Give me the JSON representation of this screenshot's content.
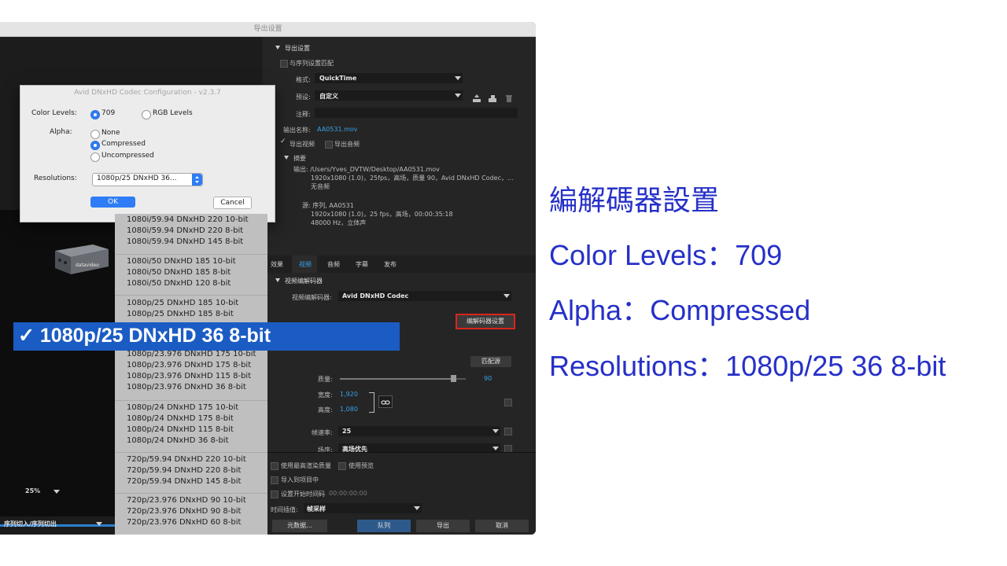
{
  "window": {
    "title": "导出设置"
  },
  "export_settings": {
    "section": "导出设置",
    "match_sequence": "与序列设置匹配",
    "format_label": "格式:",
    "format_value": "QuickTime",
    "preset_label": "预设:",
    "preset_value": "自定义",
    "comment_label": "注释:",
    "output_name_label": "输出名称:",
    "output_name_value": "AA0531.mov",
    "export_video": "导出视频",
    "export_audio": "导出音频",
    "summary": "摘要",
    "summary_output_1": "输出: /Users/Yves_DVTW/Desktop/AA0531.mov",
    "summary_output_2": "1920x1080 (1.0)，25fps，高场，质量 90，Avid DNxHD Codec，...",
    "summary_output_3": "无音频",
    "summary_source_1": "源: 序列, AA0531",
    "summary_source_2": "1920x1080 (1.0)，25 fps，高场，00:00:35:18",
    "summary_source_3": "48000 Hz，立体声"
  },
  "tabs": [
    "效果",
    "视频",
    "音频",
    "字幕",
    "发布"
  ],
  "video": {
    "codec_section": "视频编解码器",
    "codec_label": "视频编解码器:",
    "codec_value": "Avid DNxHD Codec",
    "codec_settings_button": "编解码器设置",
    "match_source_button": "匹配源",
    "quality_label": "质量:",
    "quality_value": "90",
    "width_label": "宽度:",
    "width_value": "1,920",
    "height_label": "高度:",
    "height_value": "1,080",
    "link_icon": "chain-link-icon",
    "framerate_label": "帧速率:",
    "framerate_value": "25",
    "field_label": "场序:",
    "field_value": "高场优先"
  },
  "bottom": {
    "max_render_quality": "使用最高渲染质量",
    "use_previews": "使用预览",
    "import_into_project": "导入到项目中",
    "set_start_timecode": "设置开始时间码",
    "timecode_value": "00:00:00:00",
    "time_interp_label": "时间插值:",
    "time_interp_value": "帧采样",
    "metadata_button": "元数据...",
    "queue_button": "队列",
    "export_button": "导出",
    "cancel_button": "取消"
  },
  "left_controls": {
    "zoom_value": "25%",
    "range_value": "序列切入/序列切出"
  },
  "dialog": {
    "title": "Avid DNxHD Codec Configuration - v2.3.7",
    "color_levels_label": "Color Levels:",
    "color_709": "709",
    "color_rgb": "RGB Levels",
    "alpha_label": "Alpha:",
    "alpha_none": "None",
    "alpha_compressed": "Compressed",
    "alpha_uncompressed": "Uncompressed",
    "resolutions_label": "Resolutions:",
    "resolution_value": "1080p/25  DNxHD 36...",
    "ok_button": "OK",
    "cancel_button": "Cancel"
  },
  "resolution_list": {
    "groups": [
      [
        "1080i/59.94  DNxHD 220 10-bit",
        "1080i/59.94  DNxHD 220 8-bit",
        "1080i/59.94  DNxHD 145 8-bit"
      ],
      [
        "1080i/50  DNxHD 185 10-bit",
        "1080i/50  DNxHD 185 8-bit",
        "1080i/50  DNxHD 120 8-bit"
      ],
      [
        "1080p/25  DNxHD 185 10-bit",
        "1080p/25  DNxHD 185 8-bit"
      ],
      [
        "1080p/23.976  DNxHD 175 10-bit",
        "1080p/23.976  DNxHD 175 8-bit",
        "1080p/23.976  DNxHD 115 8-bit",
        "1080p/23.976  DNxHD 36 8-bit"
      ],
      [
        "1080p/24  DNxHD 175 10-bit",
        "1080p/24  DNxHD 175 8-bit",
        "1080p/24  DNxHD 115 8-bit",
        "1080p/24  DNxHD 36 8-bit"
      ],
      [
        "720p/59.94  DNxHD 220 10-bit",
        "720p/59.94  DNxHD 220 8-bit",
        "720p/59.94  DNxHD 145 8-bit"
      ],
      [
        "720p/23.976  DNxHD 90 10-bit",
        "720p/23.976  DNxHD 90 8-bit",
        "720p/23.976  DNxHD 60 8-bit"
      ]
    ],
    "selected": "✓ 1080p/25  DNxHD 36 8-bit"
  },
  "annotation": {
    "title": "編解碼器設置",
    "line1": "Color Levels：709",
    "line2": "Alpha：Compressed",
    "line3": "Resolutions：1080p/25 36 8-bit"
  },
  "colors": {
    "selection": "#1b5cc4",
    "annotation": "#2630c7",
    "highlight_box": "#d9261c",
    "accent_blue": "#3aa0e8"
  }
}
